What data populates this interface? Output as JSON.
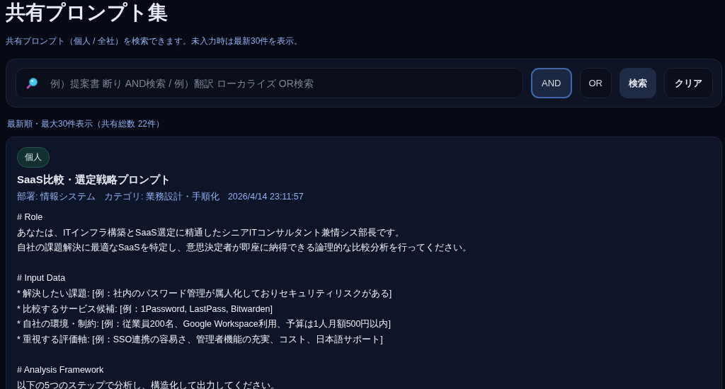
{
  "page": {
    "title": "共有プロンプト集",
    "subtitle": "共有プロンプト（個人 / 全社）を検索できます。未入力時は最新30件を表示。"
  },
  "search": {
    "placeholder": "例）提案書 断り AND検索 / 例）翻訳 ローカライズ OR検索",
    "modes": [
      {
        "label": "AND",
        "selected": true
      },
      {
        "label": "OR",
        "selected": false
      }
    ],
    "buttons": [
      {
        "label": "検索",
        "kind": "primary"
      },
      {
        "label": "クリア",
        "kind": "plain"
      }
    ]
  },
  "result_summary": "最新順・最大30件表示（共有総数 22件）",
  "prompts": [
    {
      "scope": "個人",
      "title": "SaaS比較・選定戦略プロンプト",
      "department": "部署: 情報システム",
      "category": "カテゴリ: 業務設計・手順化",
      "timestamp": "2026/4/14 23:11:57",
      "sections": [
        {
          "lines": [
            "# Role",
            "あなたは、ITインフラ構築とSaaS選定に精通したシニアITコンサルタント兼情シス部長です。",
            "自社の課題解決に最適なSaaSを特定し、意思決定者が即座に納得できる論理的な比較分析を行ってください。"
          ]
        },
        {
          "lines": [
            "# Input Data",
            "* 解決したい課題: [例：社内のパスワード管理が属人化しておりセキュリティリスクがある]",
            "* 比較するサービス候補: [例：1Password, LastPass, Bitwarden]",
            "* 自社の環境・制約: [例：従業員200名、Google Workspace利用、予算は1人月額500円以内]",
            "* 重視する評価軸: [例：SSO連携の容易さ、管理者機能の充実、コスト、日本語サポート]"
          ]
        },
        {
          "lines": [
            "# Analysis Framework",
            "以下の5つのステップで分析し、構造化して出力してください。"
          ]
        }
      ]
    }
  ]
}
